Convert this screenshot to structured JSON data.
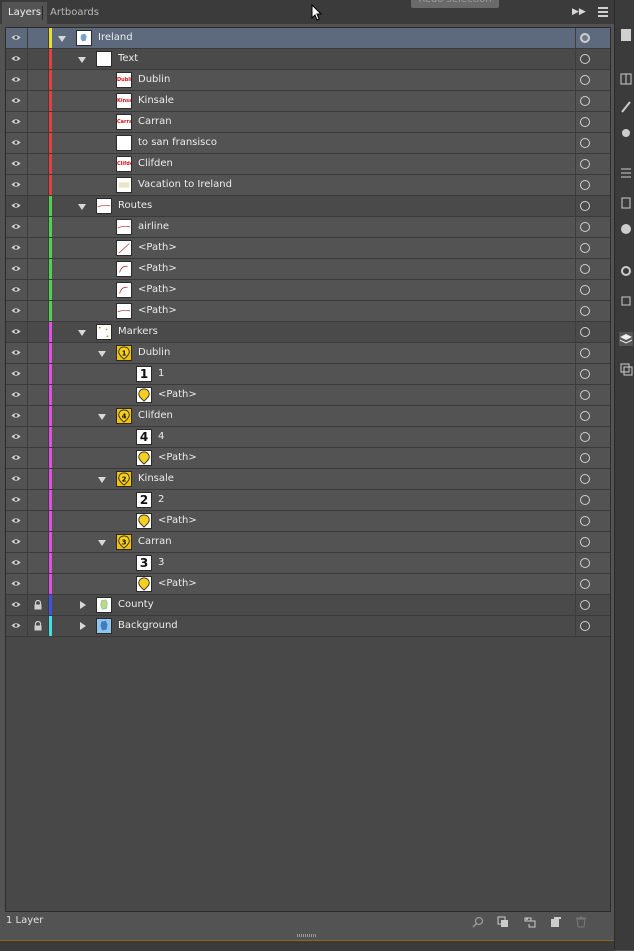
{
  "tabs": {
    "layers": "Layers",
    "artboards": "Artboards"
  },
  "tooltip": "Redo selection",
  "rows": [
    {
      "label": "Ireland",
      "depth": 0,
      "expand": "down",
      "bar": "#e8e030",
      "thumb": "map",
      "kind": "top",
      "locked": false,
      "target": "selected"
    },
    {
      "label": "Text",
      "depth": 1,
      "expand": "down",
      "bar": "#e04040",
      "thumb": "blank",
      "kind": "layer"
    },
    {
      "label": "Dublin",
      "depth": 2,
      "expand": "none",
      "bar": "#e04040",
      "thumb": "text",
      "thumb_text": "Dublin",
      "kind": "item"
    },
    {
      "label": "Kinsale",
      "depth": 2,
      "expand": "none",
      "bar": "#e04040",
      "thumb": "text",
      "thumb_text": "Kinsale",
      "kind": "item"
    },
    {
      "label": "Carran",
      "depth": 2,
      "expand": "none",
      "bar": "#e04040",
      "thumb": "text",
      "thumb_text": "Carran",
      "kind": "item"
    },
    {
      "label": "to san fransisco",
      "depth": 2,
      "expand": "none",
      "bar": "#e04040",
      "thumb": "blank",
      "kind": "item"
    },
    {
      "label": "Clifden",
      "depth": 2,
      "expand": "none",
      "bar": "#e04040",
      "thumb": "text",
      "thumb_text": "Clifden",
      "kind": "item"
    },
    {
      "label": "Vacation to Ireland",
      "depth": 2,
      "expand": "none",
      "bar": "#e04040",
      "thumb": "faint",
      "kind": "item"
    },
    {
      "label": "Routes",
      "depth": 1,
      "expand": "down",
      "bar": "#50d050",
      "thumb": "line",
      "kind": "layer"
    },
    {
      "label": "airline",
      "depth": 2,
      "expand": "none",
      "bar": "#50d050",
      "thumb": "line",
      "kind": "item"
    },
    {
      "label": "<Path>",
      "depth": 2,
      "expand": "none",
      "bar": "#50d050",
      "thumb": "diag",
      "kind": "item"
    },
    {
      "label": "<Path>",
      "depth": 2,
      "expand": "none",
      "bar": "#50d050",
      "thumb": "curve",
      "kind": "item"
    },
    {
      "label": "<Path>",
      "depth": 2,
      "expand": "none",
      "bar": "#50d050",
      "thumb": "curve",
      "kind": "item"
    },
    {
      "label": "<Path>",
      "depth": 2,
      "expand": "none",
      "bar": "#50d050",
      "thumb": "line",
      "kind": "item"
    },
    {
      "label": "Markers",
      "depth": 1,
      "expand": "down",
      "bar": "#e050e0",
      "thumb": "dots",
      "kind": "layer"
    },
    {
      "label": "Dublin",
      "depth": 2,
      "expand": "down",
      "bar": "#e050e0",
      "thumb": "marker",
      "thumb_text": "1",
      "kind": "item"
    },
    {
      "label": "1",
      "depth": 3,
      "expand": "none",
      "bar": "#e050e0",
      "thumb": "num",
      "thumb_text": "1",
      "kind": "item"
    },
    {
      "label": "<Path>",
      "depth": 3,
      "expand": "none",
      "bar": "#e050e0",
      "thumb": "pin",
      "kind": "item"
    },
    {
      "label": "Clifden",
      "depth": 2,
      "expand": "down",
      "bar": "#e050e0",
      "thumb": "marker",
      "thumb_text": "4",
      "kind": "item"
    },
    {
      "label": "4",
      "depth": 3,
      "expand": "none",
      "bar": "#e050e0",
      "thumb": "num",
      "thumb_text": "4",
      "kind": "item"
    },
    {
      "label": "<Path>",
      "depth": 3,
      "expand": "none",
      "bar": "#e050e0",
      "thumb": "pin",
      "kind": "item"
    },
    {
      "label": "Kinsale",
      "depth": 2,
      "expand": "down",
      "bar": "#e050e0",
      "thumb": "marker",
      "thumb_text": "2",
      "kind": "item"
    },
    {
      "label": "2",
      "depth": 3,
      "expand": "none",
      "bar": "#e050e0",
      "thumb": "num",
      "thumb_text": "2",
      "kind": "item"
    },
    {
      "label": "<Path>",
      "depth": 3,
      "expand": "none",
      "bar": "#e050e0",
      "thumb": "pin",
      "kind": "item"
    },
    {
      "label": "Carran",
      "depth": 2,
      "expand": "down",
      "bar": "#e050e0",
      "thumb": "marker",
      "thumb_text": "3",
      "kind": "item"
    },
    {
      "label": "3",
      "depth": 3,
      "expand": "none",
      "bar": "#e050e0",
      "thumb": "num",
      "thumb_text": "3",
      "kind": "item"
    },
    {
      "label": "<Path>",
      "depth": 3,
      "expand": "none",
      "bar": "#e050e0",
      "thumb": "pin",
      "kind": "item"
    },
    {
      "label": "County",
      "depth": 1,
      "expand": "right",
      "bar": "#4050e0",
      "thumb": "county",
      "kind": "layer",
      "locked": true
    },
    {
      "label": "Background",
      "depth": 1,
      "expand": "right",
      "bar": "#40e0e0",
      "thumb": "background",
      "kind": "layer",
      "locked": true
    }
  ],
  "footer": {
    "count": "1 Layer",
    "icons": [
      "locate-object-icon",
      "make-clipping-mask-icon",
      "create-sublayer-icon",
      "create-layer-icon",
      "delete-icon"
    ]
  }
}
